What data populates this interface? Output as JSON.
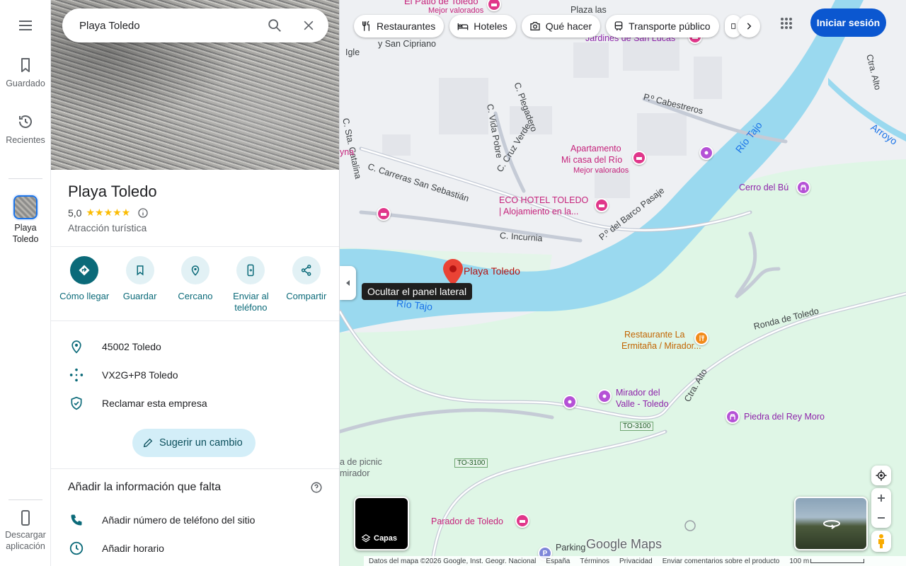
{
  "search": {
    "value": "Playa Toledo"
  },
  "rail": {
    "menu_icon": "menu-icon",
    "saved": "Guardado",
    "recent": "Recientes",
    "current_place": "Playa Toledo",
    "download": "Descargar aplicación"
  },
  "place": {
    "title": "Playa Toledo",
    "rating": "5,0",
    "stars": "★★★★★",
    "category": "Atracción turística"
  },
  "actions": [
    {
      "label": "Cómo llegar",
      "icon": "directions-icon"
    },
    {
      "label": "Guardar",
      "icon": "bookmark-icon"
    },
    {
      "label": "Cercano",
      "icon": "nearby-icon"
    },
    {
      "label": "Enviar al teléfono",
      "icon": "send-to-phone-icon"
    },
    {
      "label": "Compartir",
      "icon": "share-icon"
    }
  ],
  "info": {
    "address": "45002 Toledo",
    "plus_code": "VX2G+P8 Toledo",
    "claim": "Reclamar esta empresa"
  },
  "suggest_label": "Sugerir un cambio",
  "missing": {
    "title": "Añadir la información que falta",
    "phone": "Añadir número de teléfono del sitio",
    "hours": "Añadir horario"
  },
  "chips": [
    "Restaurantes",
    "Hoteles",
    "Qué hacer",
    "Transporte público"
  ],
  "signin": "Iniciar sesión",
  "collapse_tooltip": "Ocultar el panel lateral",
  "layers_label": "Capas",
  "brand": "Google Maps",
  "footer": {
    "data": "Datos del mapa ©2026 Google, Inst. Geogr. Nacional",
    "country": "España",
    "terms": "Términos",
    "privacy": "Privacidad",
    "feedback": "Enviar comentarios sobre el producto",
    "scale": "100 m"
  },
  "map_labels": {
    "pin": "Playa Toledo",
    "patio_1": "El Patio de Toledo",
    "patio_2": "Mejor valorados",
    "plaza": "Plaza las",
    "cipriano": "y San Cipriano",
    "jardines": "Jardines de San Lucas",
    "iglesia": "Igle",
    "sta_catalina": "C. Sta. Catalina",
    "plegadero": "C. Plegadero",
    "vida_pobre": "C. Vida Pobre",
    "cabestreros": "P.º Cabestreros",
    "cruz_verde": "C. Cruz Verde",
    "carreras": "C. Carreras San Sebastián",
    "apart_1": "Apartamento",
    "apart_2": "Mi casa del Río",
    "apart_3": "Mejor valorados",
    "eco_1": "ECO HOTEL TOLEDO",
    "eco_2": "| Alojamiento en la...",
    "barco": "P.º del Barco Pasaje",
    "incurnia": "C. Incurnia",
    "rio_tajo_1": "Río Tajo",
    "rio_tajo_2": "Río Tajo",
    "cerro": "Cerro del Bú",
    "arroyo": "Arroyo",
    "ctra_alto_top": "Ctra. Alto",
    "ronda": "Ronda de Toledo",
    "rest_1": "Restaurante La",
    "rest_2": "Ermitaña / Mirador...",
    "ctra_alto": "Ctra. Alto",
    "mirador_1": "Mirador del",
    "mirador_2": "Valle - Toledo",
    "piedra": "Piedra del Rey Moro",
    "to3100_a": "TO-3100",
    "to3100_b": "TO-3100",
    "picnic_1": "a de picnic",
    "picnic_2": "mirador",
    "parador": "Parador de Toledo",
    "parking": "Parking",
    "yna": "yna"
  }
}
